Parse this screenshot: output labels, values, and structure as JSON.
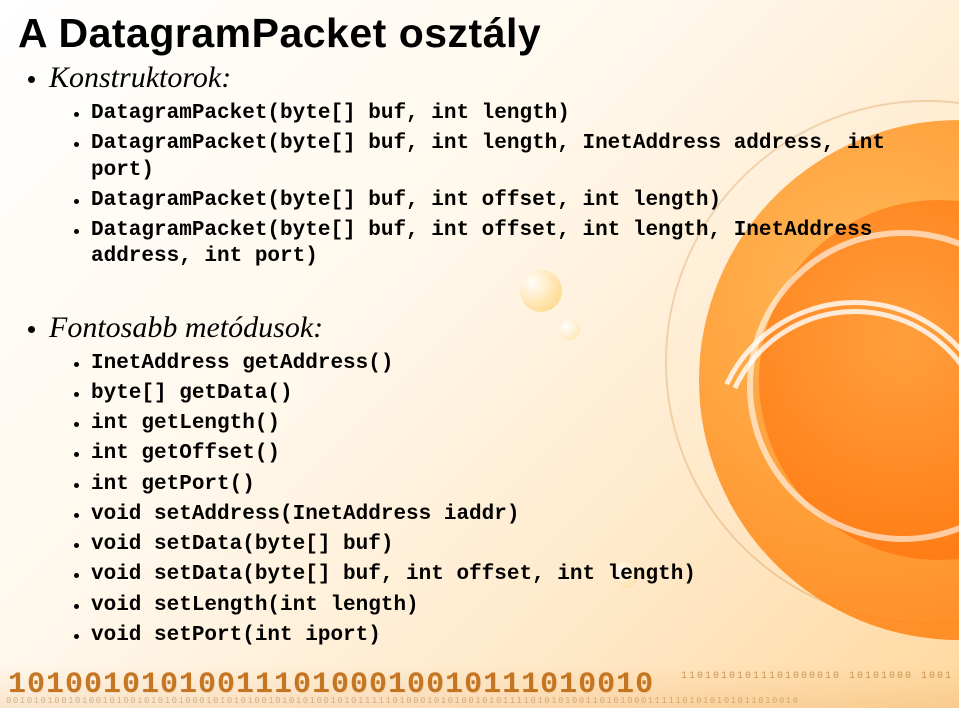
{
  "title": "A DatagramPacket osztály",
  "sections": [
    {
      "heading": "Konstruktorok:",
      "items": [
        "DatagramPacket(byte[] buf, int length)",
        "DatagramPacket(byte[] buf, int length, InetAddress address, int port)",
        "DatagramPacket(byte[] buf, int offset, int length)",
        "DatagramPacket(byte[] buf, int offset, int length, InetAddress address, int port)"
      ]
    },
    {
      "heading": "Fontosabb metódusok:",
      "items": [
        "InetAddress getAddress()",
        "byte[] getData()",
        "int getLength()",
        "int getOffset()",
        "int getPort()",
        "void setAddress(InetAddress iaddr)",
        "void setData(byte[] buf)",
        "void setData(byte[] buf, int offset, int length)",
        "void setLength(int length)",
        "void setPort(int iport)"
      ]
    }
  ],
  "decor": {
    "binary_large": "1010010101001110100010010111010010",
    "binary_small_top": "11010101011101000010   10101000   1001",
    "binary_small_bot": "0010101001010010100101010100010101010010101010010101111101000101010010101111010101001101010001111101010101011010010"
  }
}
